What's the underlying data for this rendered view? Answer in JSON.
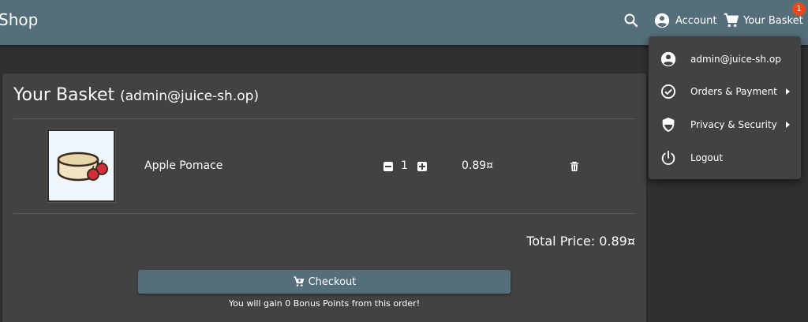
{
  "header": {
    "title": "Shop",
    "search_icon": "search-icon",
    "account_label": "Account",
    "basket_label": "Your Basket",
    "basket_count": "1",
    "primary_color": "#546e7a",
    "badge_color": "#e64a19"
  },
  "basket": {
    "title": "Your Basket",
    "owner": "(admin@juice-sh.op)",
    "items": [
      {
        "name": "Apple Pomace",
        "quantity": "1",
        "price": "0.89¤"
      }
    ],
    "total": "Total Price: 0.89¤",
    "checkout_label": "Checkout",
    "bonus_text": "You will gain 0 Bonus Points from this order!"
  },
  "account_menu": {
    "items": [
      {
        "label": "admin@juice-sh.op",
        "icon": "account-circle-icon",
        "submenu": false
      },
      {
        "label": "Orders & Payment",
        "icon": "check-circle-icon",
        "submenu": true
      },
      {
        "label": "Privacy & Security",
        "icon": "shield-icon",
        "submenu": true
      },
      {
        "label": "Logout",
        "icon": "power-icon",
        "submenu": false
      }
    ]
  }
}
